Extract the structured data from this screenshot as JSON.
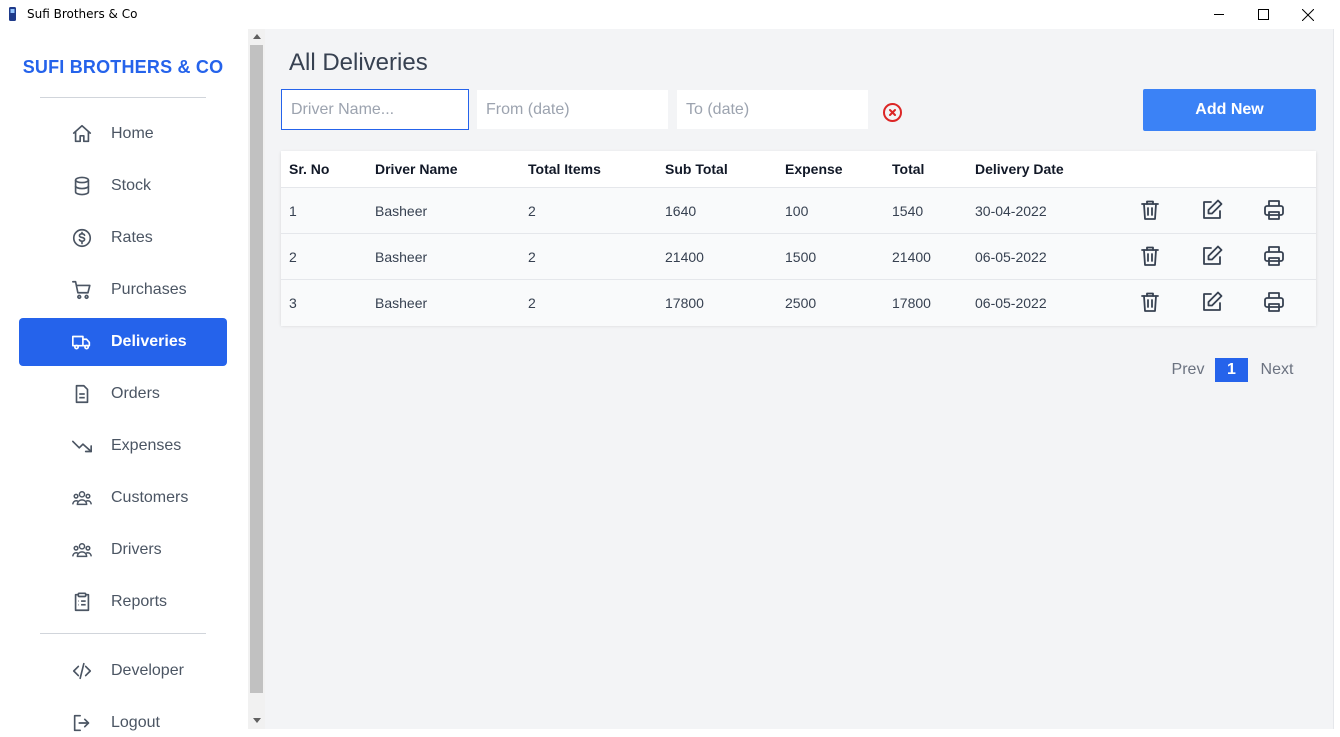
{
  "window": {
    "title": "Sufi Brothers & Co"
  },
  "sidebar": {
    "brand": "SUFI BROTHERS & CO",
    "items": [
      {
        "label": "Home",
        "icon": "home-icon"
      },
      {
        "label": "Stock",
        "icon": "database-icon"
      },
      {
        "label": "Rates",
        "icon": "dollar-circle-icon"
      },
      {
        "label": "Purchases",
        "icon": "cart-icon"
      },
      {
        "label": "Deliveries",
        "icon": "truck-icon",
        "active": true
      },
      {
        "label": "Orders",
        "icon": "document-icon"
      },
      {
        "label": "Expenses",
        "icon": "trending-down-icon"
      },
      {
        "label": "Customers",
        "icon": "user-group-icon"
      },
      {
        "label": "Drivers",
        "icon": "user-group-icon"
      },
      {
        "label": "Reports",
        "icon": "clipboard-list-icon"
      }
    ],
    "footer_items": [
      {
        "label": "Developer",
        "icon": "code-icon"
      },
      {
        "label": "Logout",
        "icon": "logout-icon"
      }
    ]
  },
  "main": {
    "title": "All Deliveries",
    "filters": {
      "driver_placeholder": "Driver Name...",
      "from_placeholder": "From (date)",
      "to_placeholder": "To (date)"
    },
    "add_button": "Add New",
    "table": {
      "headers": [
        "Sr. No",
        "Driver Name",
        "Total Items",
        "Sub Total",
        "Expense",
        "Total",
        "Delivery Date"
      ],
      "rows": [
        [
          "1",
          "Basheer",
          "2",
          "1640",
          "100",
          "1540",
          "30-04-2022"
        ],
        [
          "2",
          "Basheer",
          "2",
          "21400",
          "1500",
          "21400",
          "06-05-2022"
        ],
        [
          "3",
          "Basheer",
          "2",
          "17800",
          "2500",
          "17800",
          "06-05-2022"
        ]
      ],
      "row_actions": [
        "trash-icon",
        "edit-icon",
        "printer-icon"
      ]
    },
    "pagination": {
      "prev": "Prev",
      "current": "1",
      "next": "Next"
    }
  },
  "colors": {
    "accent": "#2563eb",
    "button": "#3b82f6",
    "clear": "#dc2626"
  }
}
